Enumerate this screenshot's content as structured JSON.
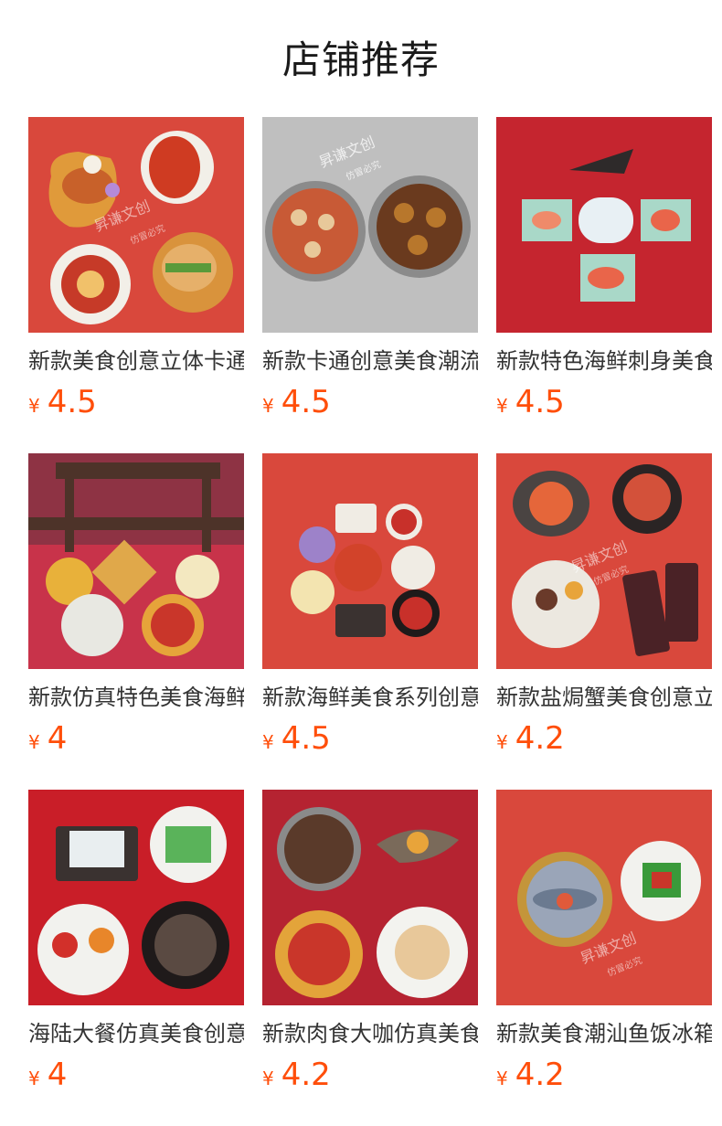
{
  "header": {
    "title": "店铺推荐"
  },
  "products": [
    {
      "name": "新款美食创意立体卡通",
      "currency": "¥",
      "price": "4.5",
      "bg": "#d9483c",
      "watermark": "昇谦文创",
      "stamp": "仿冒必究",
      "thumb": "food-magnets-lobster-bird"
    },
    {
      "name": "新款卡通创意美食潮流",
      "currency": "¥",
      "price": "4.5",
      "bg": "#bfbfbf",
      "watermark": "昇谦文创",
      "stamp": "仿冒必究",
      "thumb": "food-magnets-pots"
    },
    {
      "name": "新款特色海鲜刺身美食",
      "currency": "¥",
      "price": "4.5",
      "bg": "#c5252f",
      "watermark": "",
      "stamp": "",
      "thumb": "food-magnets-sashimi"
    },
    {
      "name": "新款仿真特色美食海鲜",
      "currency": "¥",
      "price": "4",
      "bg": "#c8334a",
      "watermark": "",
      "stamp": "",
      "thumb": "food-magnets-furniture"
    },
    {
      "name": "新款海鲜美食系列创意",
      "currency": "¥",
      "price": "4.5",
      "bg": "#d9483c",
      "watermark": "",
      "stamp": "",
      "thumb": "food-magnets-seafood"
    },
    {
      "name": "新款盐焗蟹美食创意立",
      "currency": "¥",
      "price": "4.2",
      "bg": "#d9483c",
      "watermark": "昇谦文创",
      "stamp": "仿冒必究",
      "thumb": "food-magnets-crab"
    },
    {
      "name": "海陆大餐仿真美食创意",
      "currency": "¥",
      "price": "4",
      "bg": "#c91e28",
      "watermark": "",
      "stamp": "",
      "thumb": "food-magnets-feast"
    },
    {
      "name": "新款肉食大咖仿真美食",
      "currency": "¥",
      "price": "4.2",
      "bg": "#b52331",
      "watermark": "",
      "stamp": "",
      "thumb": "food-magnets-meat"
    },
    {
      "name": "新款美食潮汕鱼饭冰箱",
      "currency": "¥",
      "price": "4.2",
      "bg": "#d9483c",
      "watermark": "昇谦文创",
      "stamp": "仿冒必究",
      "thumb": "food-magnets-fish"
    }
  ]
}
